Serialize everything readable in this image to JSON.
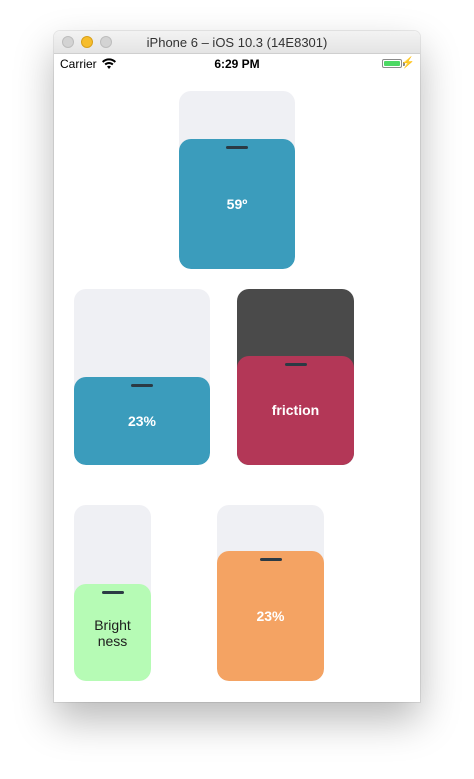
{
  "window": {
    "title": "iPhone 6 – iOS 10.3 (14E8301)"
  },
  "statusbar": {
    "carrier": "Carrier",
    "time": "6:29 PM",
    "wifi_icon": "wifi-icon",
    "battery_icon": "battery-icon",
    "charging_icon": "charging-bolt-icon",
    "battery_level": 1.0
  },
  "controls": [
    {
      "id": "temperature",
      "label": "59º",
      "fill_level": 0.73,
      "fill_color": "#3b9cbc",
      "track_color": "#eff0f4",
      "label_color": "#ffffff"
    },
    {
      "id": "percent-blue",
      "label": "23%",
      "fill_level": 0.5,
      "fill_color": "#3b9cbc",
      "track_color": "#eff0f4",
      "label_color": "#ffffff"
    },
    {
      "id": "friction",
      "label": "friction",
      "fill_level": 0.62,
      "fill_color": "#b33757",
      "track_color": "#4a4a4a",
      "label_color": "#ffffff"
    },
    {
      "id": "brightness",
      "label": "Bright\nness",
      "fill_level": 0.55,
      "fill_color": "#b6fbb5",
      "track_color": "#eff0f4",
      "label_color": "#1d1d1d"
    },
    {
      "id": "percent-orange",
      "label": "23%",
      "fill_level": 0.74,
      "fill_color": "#f4a363",
      "track_color": "#eff0f4",
      "label_color": "#ffffff"
    }
  ]
}
